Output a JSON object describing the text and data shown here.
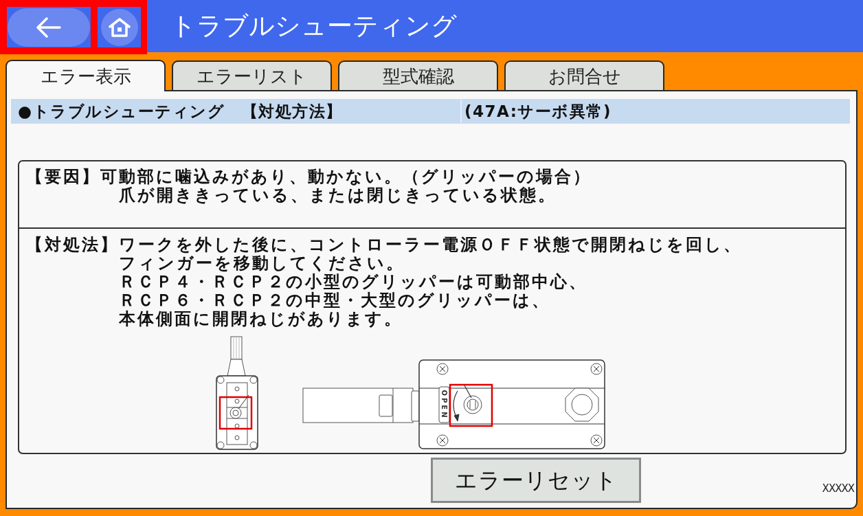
{
  "header": {
    "nav_buttons": [
      {
        "kind": "back"
      },
      {
        "kind": "home"
      }
    ],
    "nav_highlighted": true,
    "title": "トラブルシューティング"
  },
  "tabs": [
    {
      "label": "エラー表示",
      "selected": true
    },
    {
      "label": "エラーリスト",
      "selected": false
    },
    {
      "label": "型式確認",
      "selected": false
    },
    {
      "label": "お問合せ",
      "selected": false
    }
  ],
  "title_bar": {
    "heading": "●トラブルシューティング　【対処方法】",
    "error": "(47A:サーボ異常)"
  },
  "sections": [
    {
      "label": "【要因】",
      "lines": [
        "可動部に噛込みがあり、動かない。（グリッパーの場合）",
        "爪が開ききっている、または閉じきっている状態。"
      ]
    },
    {
      "label": "【対処法】",
      "lines": [
        "ワークを外した後に、コントローラー電源ＯＦＦ状態で開閉ねじを回し、",
        "フィンガーを移動してください。",
        "ＲＣＰ４・ＲＣＰ２の小型のグリッパーは可動部中心、",
        "ＲＣＰ６・ＲＣＰ２の中型・大型のグリッパーは、",
        "本体側面に開閉ねじがあります。"
      ]
    }
  ],
  "diagram": {
    "plate_label": "OPEN"
  },
  "reset_button": "エラーリセット",
  "footer_code": "XXXXX"
}
